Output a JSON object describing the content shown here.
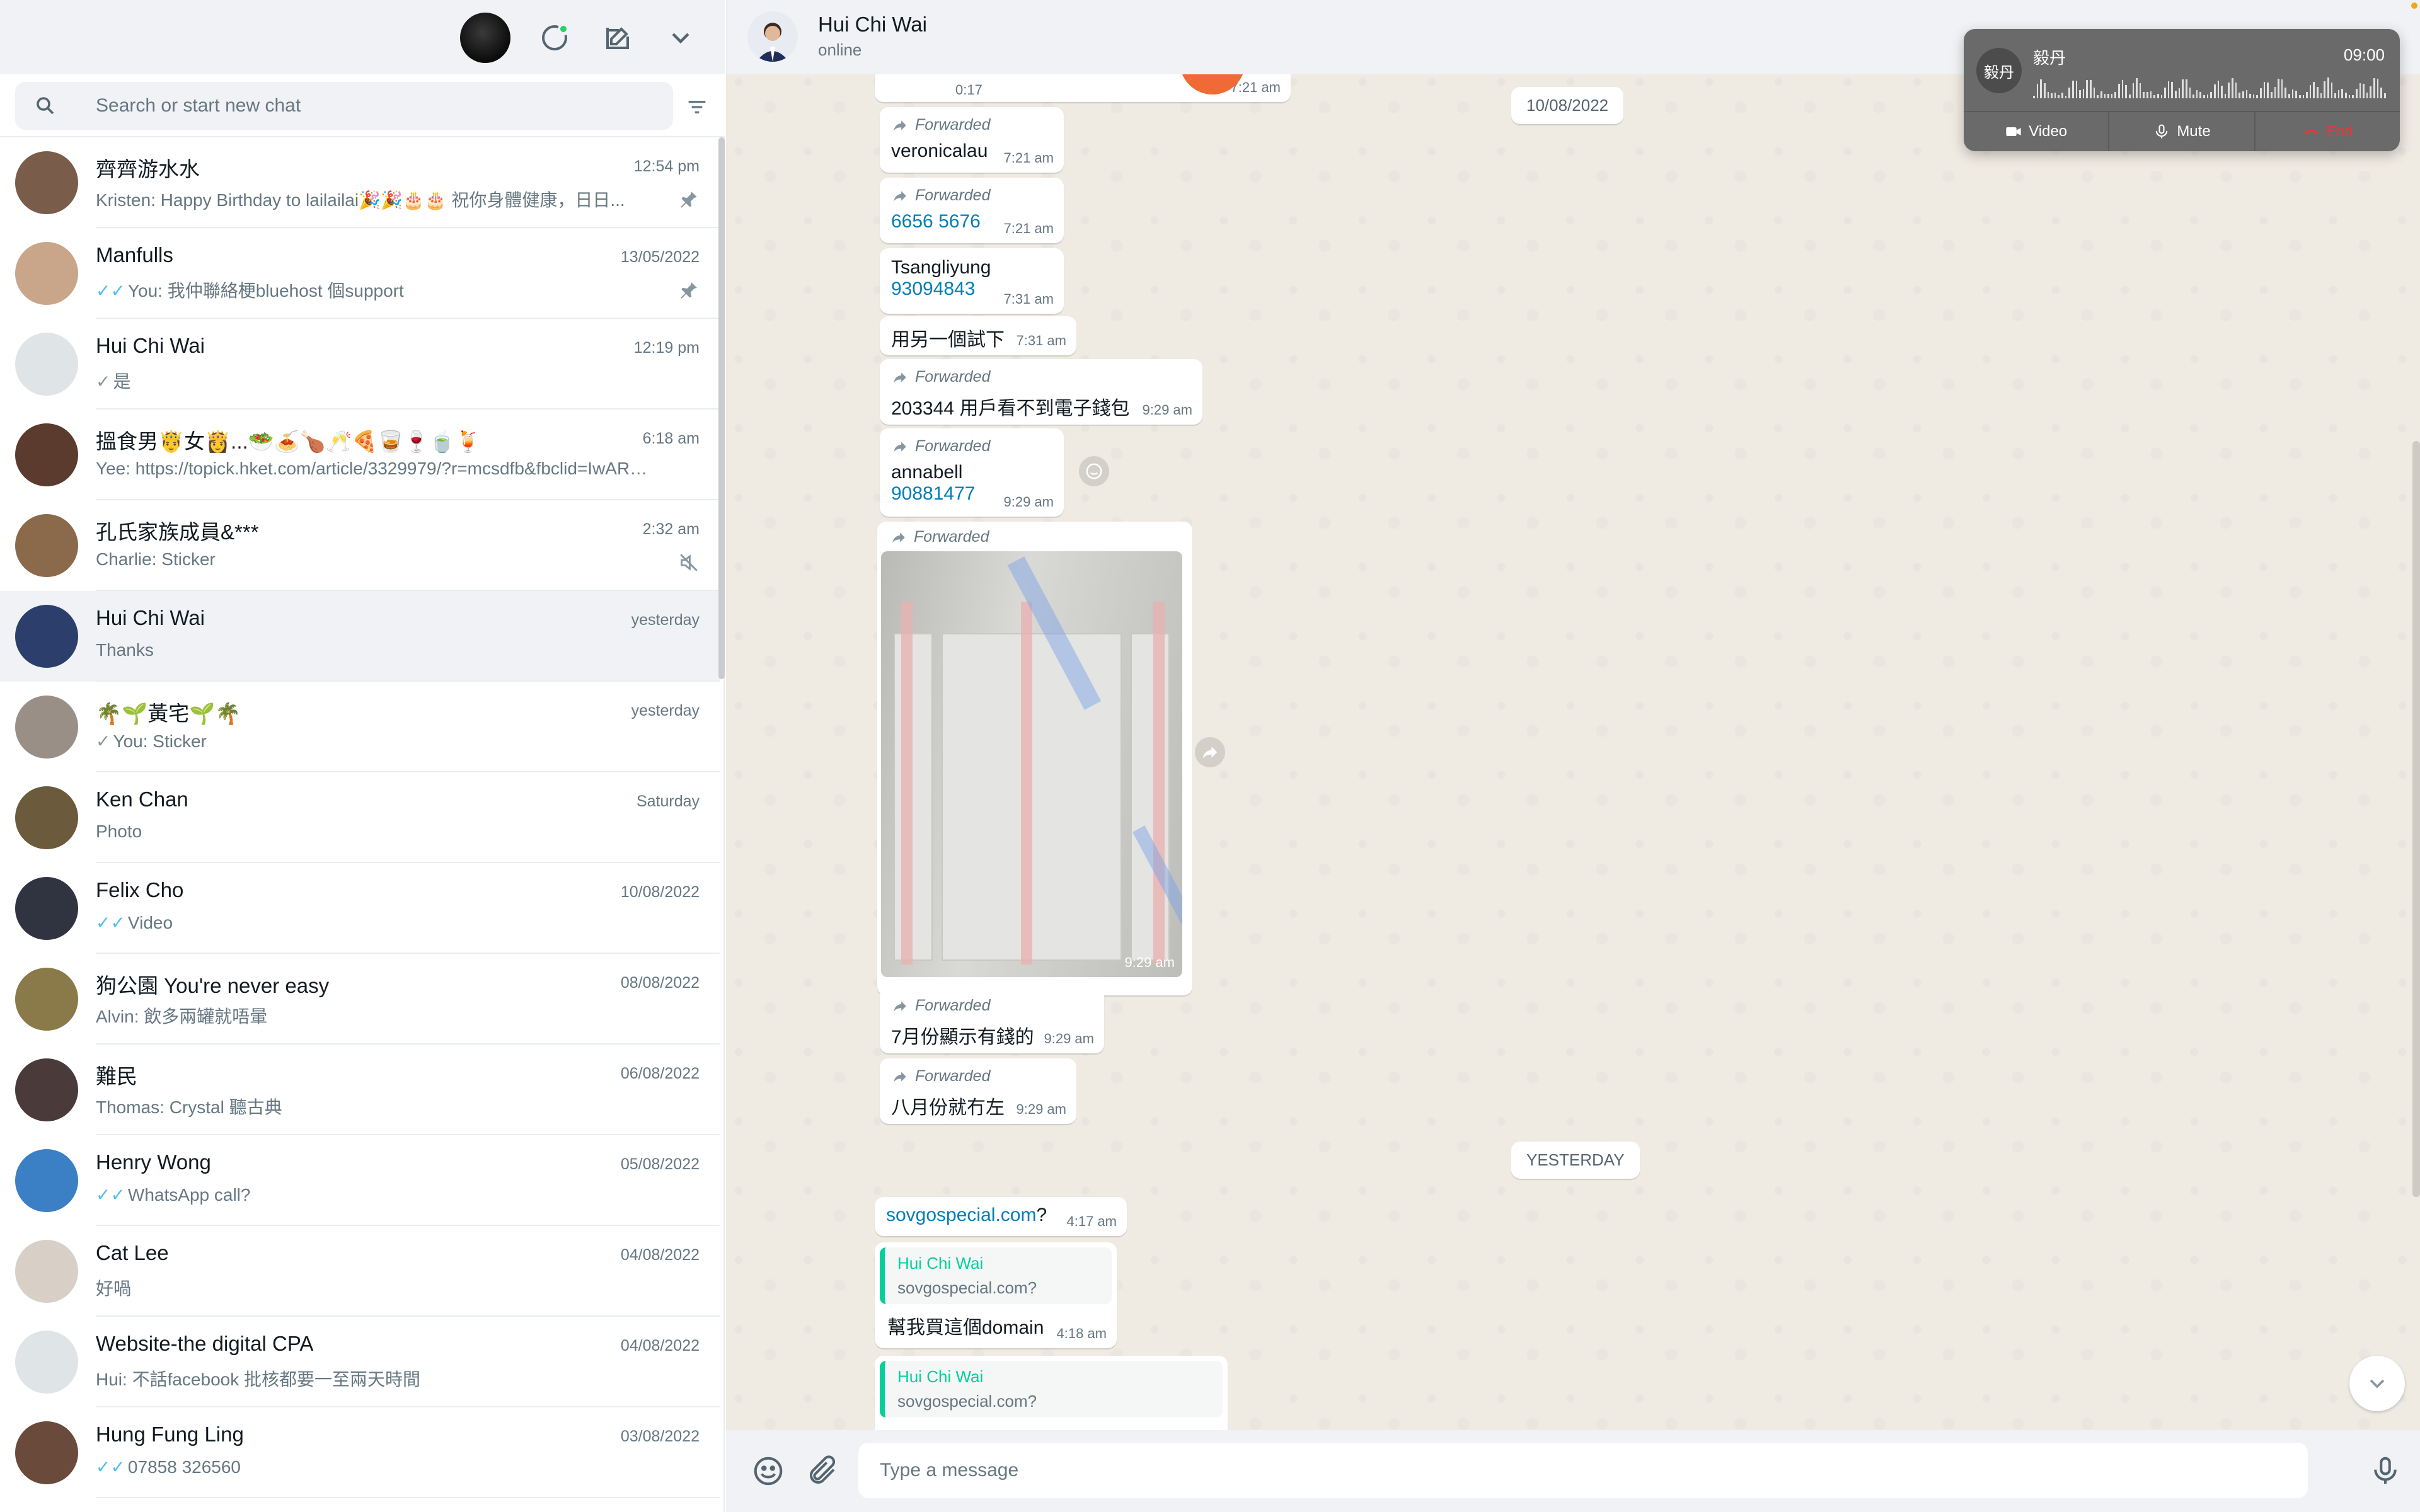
{
  "sidebar": {
    "search_placeholder": "Search or start new chat",
    "chats": [
      {
        "name": "齊齊游水水",
        "time": "12:54 pm",
        "preview": "Kristen: Happy Birthday to lailailai🎉🎉🎂🎂 祝你身體健康，日日...",
        "tick": "",
        "icon": "pin-icon",
        "avatar_color": "#7a5c4a"
      },
      {
        "name": "Manfulls",
        "time": "13/05/2022",
        "preview": "You: 我仲聯絡梗bluehost 個support",
        "tick": "blue",
        "icon": "pin-icon",
        "avatar_color": "#c9a58a"
      },
      {
        "name": "Hui Chi Wai",
        "time": "12:19 pm",
        "preview": "是",
        "tick": "grey",
        "icon": "",
        "avatar_color": "#dfe5e7"
      },
      {
        "name": "搵食男🤴女👸...🥗🍝🍗🥂🍕🥃🍷🍵🍹",
        "time": "6:18 am",
        "preview": "Yee: https://topick.hket.com/article/3329979/?r=mcsdfb&fbclid=IwAR1...",
        "tick": "",
        "icon": "",
        "avatar_color": "#5a3b2e"
      },
      {
        "name": "孔氏家族成員&***",
        "time": "2:32 am",
        "preview": "Charlie: Sticker",
        "tick": "",
        "icon": "muted-icon",
        "avatar_color": "#8a6a4a"
      },
      {
        "name": "Hui Chi Wai",
        "time": "yesterday",
        "preview": "Thanks",
        "tick": "",
        "icon": "",
        "avatar_color": "#2c3e6b"
      },
      {
        "name": "🌴🌱黃宅🌱🌴",
        "time": "yesterday",
        "preview": "You: Sticker",
        "tick": "grey",
        "icon": "",
        "avatar_color": "#9a8f86"
      },
      {
        "name": "Ken Chan",
        "time": "Saturday",
        "preview": "Photo",
        "tick": "",
        "icon": "",
        "avatar_color": "#6b5a3c"
      },
      {
        "name": "Felix Cho",
        "time": "10/08/2022",
        "preview": "Video",
        "tick": "blue",
        "icon": "",
        "avatar_color": "#2f3440"
      },
      {
        "name": "狗公園 You're never easy",
        "time": "08/08/2022",
        "preview": "Alvin: 飲多兩罐就唔暈",
        "tick": "",
        "icon": "",
        "avatar_color": "#8a7a4a"
      },
      {
        "name": "難民",
        "time": "06/08/2022",
        "preview": "Thomas: Crystal 聽古典",
        "tick": "",
        "icon": "",
        "avatar_color": "#4a3a3a"
      },
      {
        "name": "Henry Wong",
        "time": "05/08/2022",
        "preview": "WhatsApp call?",
        "tick": "blue",
        "icon": "",
        "avatar_color": "#3b7fc4"
      },
      {
        "name": "Cat Lee",
        "time": "04/08/2022",
        "preview": "好喎",
        "tick": "",
        "icon": "",
        "avatar_color": "#d8cfc6"
      },
      {
        "name": "Website-the digital CPA",
        "time": "04/08/2022",
        "preview": "Hui: 不話facebook 批核都要一至兩天時間",
        "tick": "",
        "icon": "",
        "avatar_color": "#dfe5e7"
      },
      {
        "name": "Hung Fung Ling",
        "time": "03/08/2022",
        "preview": "07858 326560",
        "tick": "blue",
        "icon": "",
        "avatar_color": "#6a4a3a"
      }
    ]
  },
  "conversation": {
    "name": "Hui Chi Wai",
    "status": "online",
    "composer_placeholder": "Type a message",
    "forwarded_label": "Forwarded",
    "top_clip": {
      "duration": "0:17",
      "time": "7:21 am"
    },
    "date_1": "10/08/2022",
    "date_2": "YESTERDAY",
    "messages": [
      {
        "fwd": true,
        "text": "veronicalau",
        "link": "",
        "time": "7:21 am"
      },
      {
        "fwd": true,
        "text": "",
        "link": "6656 5676",
        "time": "7:21 am"
      },
      {
        "fwd": false,
        "text": "Tsangliyung",
        "link": "93094843",
        "time": "7:31 am"
      },
      {
        "fwd": false,
        "text": "用另一個試下",
        "link": "",
        "time": "7:31 am"
      },
      {
        "fwd": true,
        "text": "203344 用戶看不到電子錢包",
        "link": "",
        "time": "9:29 am"
      },
      {
        "fwd": true,
        "text": "annabell",
        "link": "90881477",
        "time": "9:29 am"
      },
      {
        "fwd": true,
        "text": "",
        "link": "",
        "time": "9:29 am"
      },
      {
        "fwd": true,
        "text": "7月份顯示有錢的",
        "link": "",
        "time": "9:29 am"
      },
      {
        "fwd": true,
        "text": "八月份就冇左",
        "link": "",
        "time": "9:29 am"
      },
      {
        "fwd": false,
        "link": "sovgospecial.com",
        "text": "?",
        "time": "4:17 am"
      },
      {
        "quote_name": "Hui Chi Wai",
        "quote_text": "sovgospecial.com?",
        "text": "幫我買這個domain",
        "time": "4:18 am"
      },
      {
        "quote_name": "Hui Chi Wai",
        "quote_text": "sovgospecial.com?"
      }
    ]
  },
  "call": {
    "name": "毅丹",
    "avatar_text": "毅丹",
    "timer": "09:00",
    "video_label": "Video",
    "mute_label": "Mute",
    "end_label": "End"
  }
}
